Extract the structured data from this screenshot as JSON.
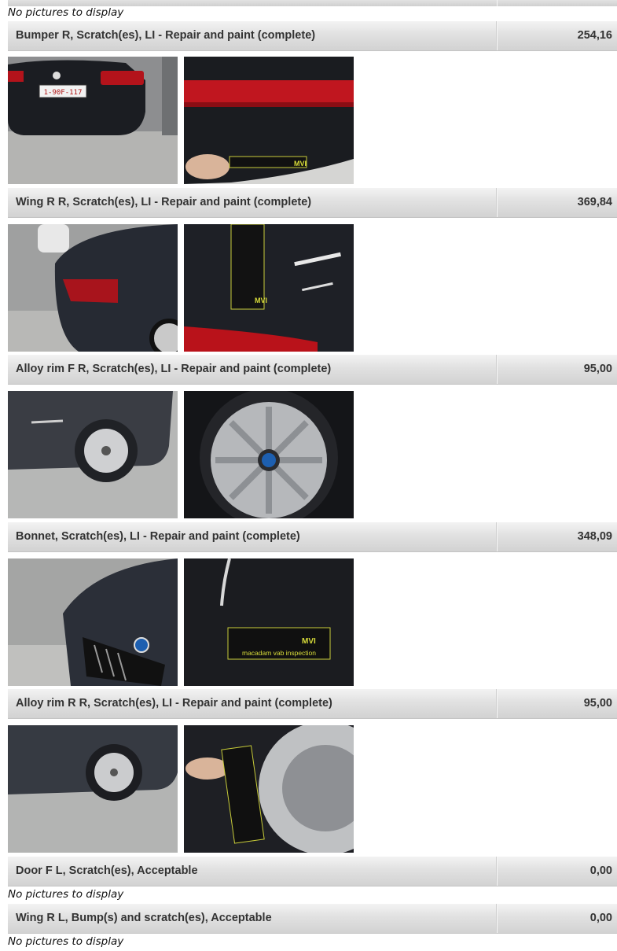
{
  "no_pictures_text": "No pictures to display",
  "damages": [
    {
      "description": "Bumper R, Scratch(es), LI - Repair and paint (complete)",
      "amount": "254,16"
    },
    {
      "description": "Wing R R, Scratch(es), LI - Repair and paint (complete)",
      "amount": "369,84"
    },
    {
      "description": "Alloy rim F R, Scratch(es), LI - Repair and paint (complete)",
      "amount": "95,00"
    },
    {
      "description": "Bonnet, Scratch(es), LI - Repair and paint (complete)",
      "amount": "348,09"
    },
    {
      "description": "Alloy rim R R, Scratch(es), LI - Repair and paint (complete)",
      "amount": "95,00"
    },
    {
      "description": "Door F L, Scratch(es), Acceptable",
      "amount": "0,00"
    },
    {
      "description": "Wing R L, Bump(s) and scratch(es), Acceptable",
      "amount": "0,00"
    }
  ],
  "photo_text": {
    "plate": "1-90F-117",
    "ruler_brand": "macadam vab inspection",
    "ruler_logo": "MVI"
  }
}
